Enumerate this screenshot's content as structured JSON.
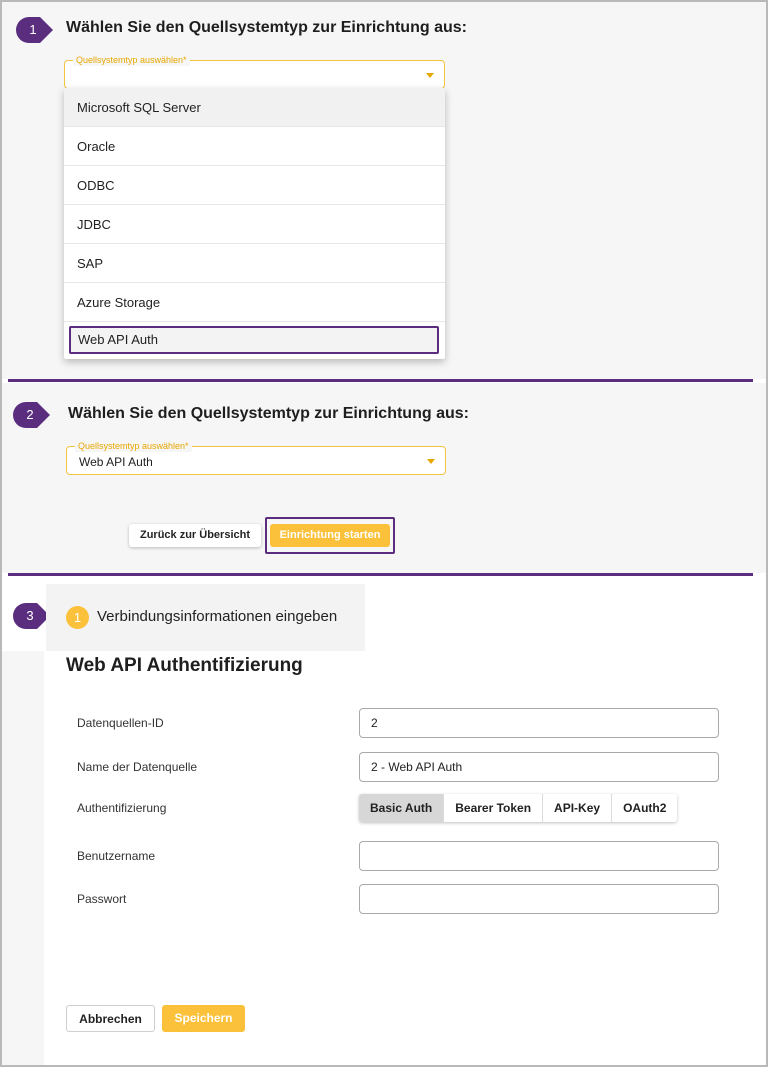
{
  "steps": [
    "1",
    "2",
    "3"
  ],
  "section1": {
    "title": "Wählen Sie den Quellsystemtyp zur Einrichtung aus:",
    "select_label": "Quellsystemtyp auswählen*",
    "select_value": "",
    "options": [
      "Microsoft SQL Server",
      "Oracle",
      "ODBC",
      "JDBC",
      "SAP",
      "Azure Storage",
      "Web API Auth"
    ]
  },
  "section2": {
    "title": "Wählen Sie den Quellsystemtyp zur Einrichtung aus:",
    "select_label": "Quellsystemtyp auswählen*",
    "select_value": "Web API Auth",
    "back_button": "Zurück zur Übersicht",
    "start_button": "Einrichtung starten"
  },
  "section3": {
    "step_number": "1",
    "step_label": "Verbindungsinformationen eingeben",
    "form_title": "Web API Authentifizierung",
    "fields": {
      "datasource_id_label": "Datenquellen-ID",
      "datasource_id_value": "2",
      "datasource_name_label": "Name der Datenquelle",
      "datasource_name_value": "2 - Web API Auth",
      "auth_label": "Authentifizierung",
      "username_label": "Benutzername",
      "username_value": "",
      "password_label": "Passwort",
      "password_value": ""
    },
    "auth_options": [
      "Basic Auth",
      "Bearer Token",
      "API-Key",
      "OAuth2"
    ],
    "auth_selected": "Basic Auth",
    "cancel_button": "Abbrechen",
    "save_button": "Speichern"
  },
  "colors": {
    "accent_yellow": "#fbc13a",
    "marker_purple": "#5a2d7e",
    "panel_gray": "#f6f6f6"
  }
}
